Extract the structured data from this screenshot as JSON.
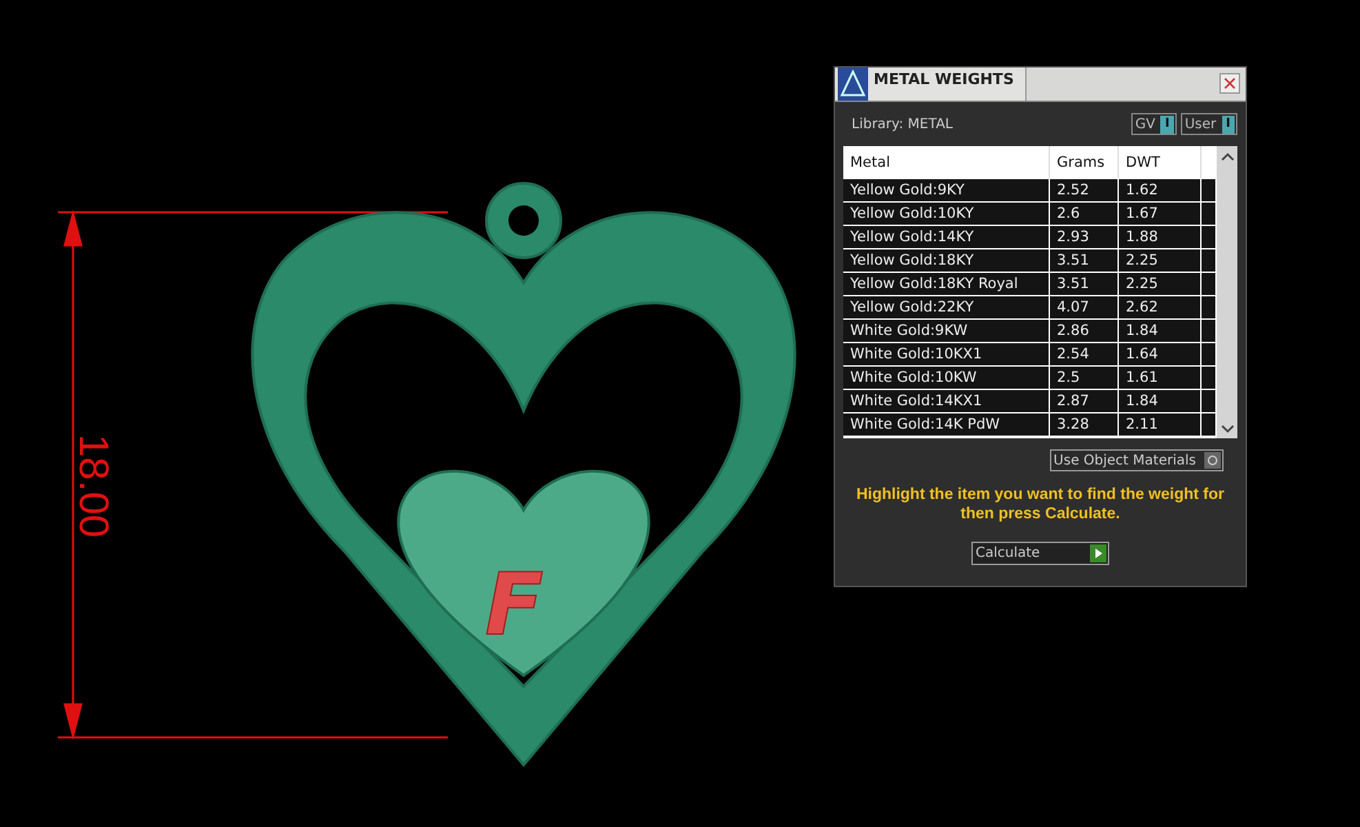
{
  "viewport": {
    "dimension_label": "18.00",
    "model_letter": "F"
  },
  "panel": {
    "title": "METAL WEIGHTS",
    "library_label": "Library: METAL",
    "toggles": [
      {
        "label": "GV",
        "indicator": "I"
      },
      {
        "label": "User",
        "indicator": "I"
      }
    ],
    "table": {
      "columns": [
        "Metal",
        "Grams",
        "DWT"
      ],
      "rows": [
        {
          "metal": "Yellow Gold:9KY",
          "grams": "2.52",
          "dwt": "1.62"
        },
        {
          "metal": "Yellow Gold:10KY",
          "grams": "2.6",
          "dwt": "1.67"
        },
        {
          "metal": "Yellow Gold:14KY",
          "grams": "2.93",
          "dwt": "1.88"
        },
        {
          "metal": "Yellow Gold:18KY",
          "grams": "3.51",
          "dwt": "2.25"
        },
        {
          "metal": "Yellow Gold:18KY Royal",
          "grams": "3.51",
          "dwt": "2.25"
        },
        {
          "metal": "Yellow Gold:22KY",
          "grams": "4.07",
          "dwt": "2.62"
        },
        {
          "metal": "White Gold:9KW",
          "grams": "2.86",
          "dwt": "1.84"
        },
        {
          "metal": "White Gold:10KX1",
          "grams": "2.54",
          "dwt": "1.64"
        },
        {
          "metal": "White Gold:10KW",
          "grams": "2.5",
          "dwt": "1.61"
        },
        {
          "metal": "White Gold:14KX1",
          "grams": "2.87",
          "dwt": "1.84"
        },
        {
          "metal": "White Gold:14K PdW",
          "grams": "3.28",
          "dwt": "2.11"
        }
      ]
    },
    "use_materials_button": "Use Object Materials",
    "hint": "Highlight the item you want to find the weight for then press Calculate.",
    "calculate_button": "Calculate"
  }
}
